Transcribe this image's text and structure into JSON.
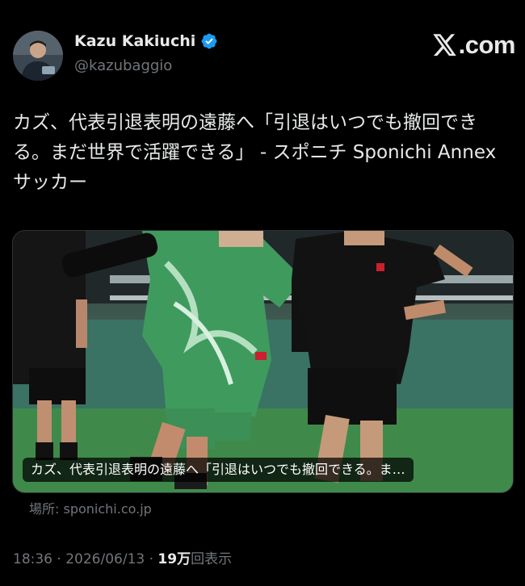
{
  "author": {
    "display_name": "Kazu Kakiuchi",
    "handle": "@kazubaggio",
    "verified": true,
    "avatar_icon": "person-photo"
  },
  "brand": {
    "logo_icon": "x-logo",
    "suffix": ".com"
  },
  "tweet": {
    "lines": [
      "カズ、代表引退表明の遠藤へ「引退はいつでも撤回でき",
      "る。まだ世界で活躍できる」 - スポニチ Sponichi Annex",
      "サッカー"
    ]
  },
  "card": {
    "caption": "カズ、代表引退表明の遠藤へ「引退はいつでも撤回できる。ま…",
    "image_icon": "soccer-players-photo",
    "source": "場所: sponichi.co.jp"
  },
  "meta": {
    "time": "18:36",
    "separator": "·",
    "date": "2026/06/13",
    "views_count": "19万",
    "views_label": "回表示"
  },
  "colors": {
    "background": "#000000",
    "text": "#e7e9ea",
    "secondary": "#71767b",
    "verified": "#1d9bf0"
  }
}
